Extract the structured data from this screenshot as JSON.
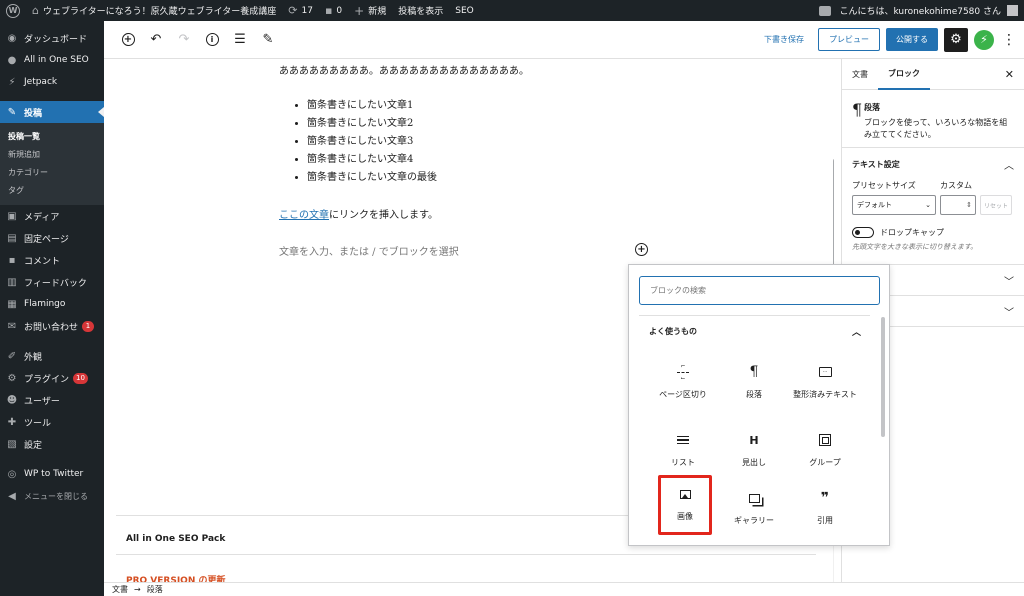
{
  "admin_bar": {
    "site_name": "ウェブライターになろう！原久蔵ウェブライター養成講座",
    "updates_count": "17",
    "comments_count": "0",
    "new_label": "新規",
    "view_post_label": "投稿を表示",
    "seo_label": "SEO",
    "greeting": "こんにちは、kuronekohime7580 さん"
  },
  "sidebar": {
    "items": [
      {
        "label": "ダッシュボード",
        "icon": "dashboard-icon"
      },
      {
        "label": "All in One SEO",
        "icon": "seo-icon"
      },
      {
        "label": "Jetpack",
        "icon": "jetpack-icon"
      },
      {
        "label": "投稿",
        "icon": "pin-icon"
      },
      {
        "label": "メディア",
        "icon": "media-icon"
      },
      {
        "label": "固定ページ",
        "icon": "page-icon"
      },
      {
        "label": "コメント",
        "icon": "comment-icon"
      },
      {
        "label": "フィードバック",
        "icon": "feedback-icon"
      },
      {
        "label": "Flamingo",
        "icon": "flamingo-icon"
      },
      {
        "label": "お問い合わせ",
        "icon": "mail-icon",
        "badge": "1"
      },
      {
        "label": "外観",
        "icon": "brush-icon"
      },
      {
        "label": "プラグイン",
        "icon": "plugin-icon",
        "badge": "10"
      },
      {
        "label": "ユーザー",
        "icon": "user-icon"
      },
      {
        "label": "ツール",
        "icon": "wrench-icon"
      },
      {
        "label": "設定",
        "icon": "settings-icon"
      },
      {
        "label": "WP to Twitter",
        "icon": "twitter-icon"
      },
      {
        "label": "メニューを閉じる",
        "icon": "collapse-icon"
      }
    ],
    "posts_submenu": [
      "投稿一覧",
      "新規追加",
      "カテゴリー",
      "タグ"
    ]
  },
  "header": {
    "save_draft": "下書き保存",
    "preview": "プレビュー",
    "publish": "公開する"
  },
  "document": {
    "first_paragraph": "あああああああああ。ああああああああああああああ。",
    "list_items": [
      "箇条書きにしたい文章1",
      "箇条書きにしたい文章2",
      "箇条書きにしたい文章3",
      "箇条書きにしたい文章4",
      "箇条書きにしたい文章の最後"
    ],
    "link_text": "ここの文章",
    "link_suffix": "にリンクを挿入します。",
    "placeholder": "文章を入力、または / でブロックを選択"
  },
  "meta": {
    "seo_pack_title": "All in One SEO Pack",
    "pro_version": "PRO VERSION の更新"
  },
  "footer": {
    "crumb_document": "文書",
    "crumb_arrow": "→",
    "crumb_block": "段落"
  },
  "settings": {
    "tab_document": "文書",
    "tab_block": "ブロック",
    "close": "✕",
    "block_title": "段落",
    "block_desc": "ブロックを使って、いろいろな物語を組み立ててください。",
    "text_settings": "テキスト設定",
    "preset_size_label": "プリセットサイズ",
    "custom_label": "カスタム",
    "preset_value": "デフォルト",
    "reset_label": "リセット",
    "drop_cap_label": "ドロップキャップ",
    "drop_cap_help": "先頭文字を大きな表示に切り替えます。"
  },
  "inserter": {
    "search_placeholder": "ブロックの検索",
    "category": "よく使うもの",
    "blocks": [
      {
        "label": "ページ区切り",
        "icon": "page-break-icon"
      },
      {
        "label": "段落",
        "icon": "paragraph-icon"
      },
      {
        "label": "整形済みテキスト",
        "icon": "preformatted-icon"
      },
      {
        "label": "リスト",
        "icon": "list-icon"
      },
      {
        "label": "見出し",
        "icon": "heading-icon"
      },
      {
        "label": "グループ",
        "icon": "group-icon"
      },
      {
        "label": "画像",
        "icon": "image-icon"
      },
      {
        "label": "ギャラリー",
        "icon": "gallery-icon"
      },
      {
        "label": "引用",
        "icon": "quote-icon"
      }
    ]
  },
  "colors": {
    "admin_dark": "#1d2327",
    "accent_blue": "#2271b1",
    "highlight_red": "#e2261c",
    "badge_red": "#d63638"
  }
}
